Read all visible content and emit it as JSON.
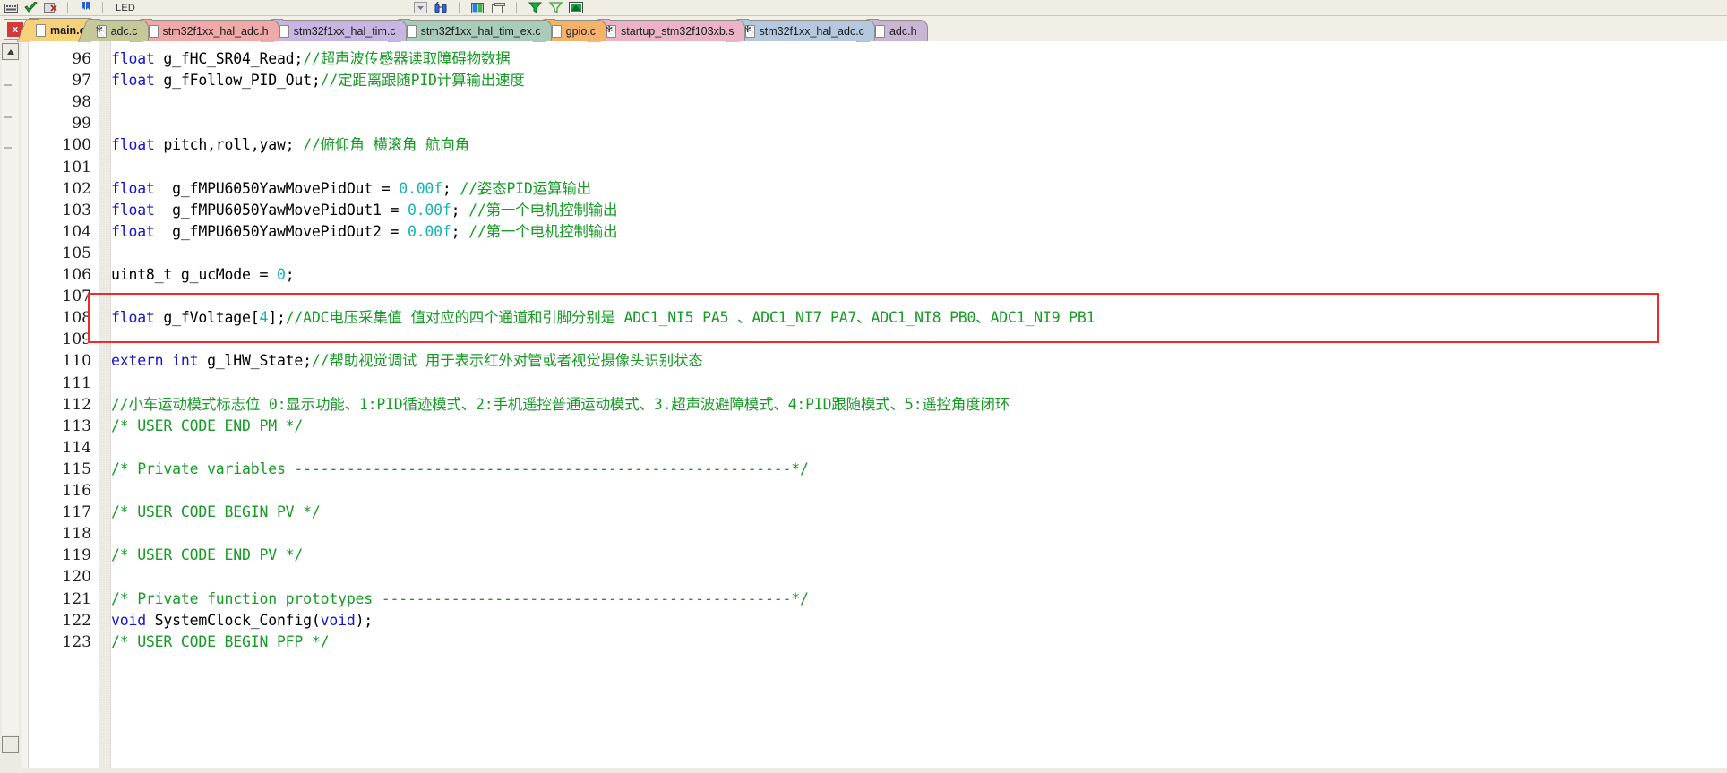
{
  "window": {
    "title": "main.c",
    "app": "Keil uVision Editor"
  },
  "toolbar": {
    "label_text": "LED",
    "icons": [
      "keyboard-icon",
      "checkmark-green-icon",
      "erase-bookmarks-icon",
      "bookmark-next-icon",
      "dropdown-arrow-icon",
      "find-binoculars-icon",
      "window-split-icon",
      "window-tile-icon",
      "filter-green-icon",
      "filter-outline-icon",
      "manage-components-icon"
    ]
  },
  "tabbar": {
    "close_label": "x",
    "tabs": [
      {
        "label": "main.c",
        "active": true,
        "color": "#f7d07a",
        "icon": "file-c-icon"
      },
      {
        "label": "adc.c",
        "active": false,
        "color": "#c6c89a",
        "icon": "file-asm-icon"
      },
      {
        "label": "stm32f1xx_hal_adc.h",
        "active": false,
        "color": "#efa9a9",
        "icon": "file-h-icon"
      },
      {
        "label": "stm32f1xx_hal_tim.c",
        "active": false,
        "color": "#c8b6e2",
        "icon": "file-c-icon"
      },
      {
        "label": "stm32f1xx_hal_tim_ex.c",
        "active": false,
        "color": "#a9cbb9",
        "icon": "file-c-icon"
      },
      {
        "label": "gpio.c",
        "active": false,
        "color": "#f5b26b",
        "icon": "file-c-icon"
      },
      {
        "label": "startup_stm32f103xb.s",
        "active": false,
        "color": "#eab4c6",
        "icon": "file-asm-icon"
      },
      {
        "label": "stm32f1xx_hal_adc.c",
        "active": false,
        "color": "#b4c8e0",
        "icon": "file-asm-icon"
      },
      {
        "label": "adc.h",
        "active": false,
        "color": "#c8b6d4",
        "icon": "file-h-icon"
      }
    ]
  },
  "colors": {
    "keyword": "#1414d0",
    "comment": "#179b26",
    "number": "#19b2b2",
    "plain": "#000000",
    "highlight_box": "#ef2b2b",
    "editor_bg": "#ffffff"
  },
  "editor": {
    "first_line_number": 96,
    "highlight": {
      "line": 108,
      "note": "red rectangle drawn around the g_fVoltage declaration line"
    },
    "lines": [
      {
        "n": 96,
        "segments": [
          {
            "t": "float ",
            "c": "kw"
          },
          {
            "t": "g_fHC_SR04_Read;",
            "c": "pl"
          },
          {
            "t": "//超声波传感器读取障碍物数据",
            "c": "cm"
          }
        ]
      },
      {
        "n": 97,
        "segments": [
          {
            "t": "float ",
            "c": "kw"
          },
          {
            "t": "g_fFollow_PID_Out;",
            "c": "pl"
          },
          {
            "t": "//定距离跟随PID计算输出速度",
            "c": "cm"
          }
        ]
      },
      {
        "n": 98,
        "segments": []
      },
      {
        "n": 99,
        "segments": []
      },
      {
        "n": 100,
        "segments": [
          {
            "t": "float ",
            "c": "kw"
          },
          {
            "t": "pitch,roll,yaw; ",
            "c": "pl"
          },
          {
            "t": "//俯仰角 横滚角 航向角",
            "c": "cm"
          }
        ]
      },
      {
        "n": 101,
        "segments": []
      },
      {
        "n": 102,
        "segments": [
          {
            "t": "float  ",
            "c": "kw"
          },
          {
            "t": "g_fMPU6050YawMovePidOut = ",
            "c": "pl"
          },
          {
            "t": "0.00f",
            "c": "num-lit"
          },
          {
            "t": "; ",
            "c": "pl"
          },
          {
            "t": "//姿态PID运算输出",
            "c": "cm"
          }
        ]
      },
      {
        "n": 103,
        "segments": [
          {
            "t": "float  ",
            "c": "kw"
          },
          {
            "t": "g_fMPU6050YawMovePidOut1 = ",
            "c": "pl"
          },
          {
            "t": "0.00f",
            "c": "num-lit"
          },
          {
            "t": "; ",
            "c": "pl"
          },
          {
            "t": "//第一个电机控制输出",
            "c": "cm"
          }
        ]
      },
      {
        "n": 104,
        "segments": [
          {
            "t": "float  ",
            "c": "kw"
          },
          {
            "t": "g_fMPU6050YawMovePidOut2 = ",
            "c": "pl"
          },
          {
            "t": "0.00f",
            "c": "num-lit"
          },
          {
            "t": "; ",
            "c": "pl"
          },
          {
            "t": "//第一个电机控制输出",
            "c": "cm"
          }
        ]
      },
      {
        "n": 105,
        "segments": []
      },
      {
        "n": 106,
        "segments": [
          {
            "t": "uint8_t g_ucMode = ",
            "c": "pl"
          },
          {
            "t": "0",
            "c": "num-lit"
          },
          {
            "t": ";",
            "c": "pl"
          }
        ]
      },
      {
        "n": 107,
        "segments": []
      },
      {
        "n": 108,
        "segments": [
          {
            "t": "float ",
            "c": "kw"
          },
          {
            "t": "g_fVoltage[",
            "c": "pl"
          },
          {
            "t": "4",
            "c": "num-lit"
          },
          {
            "t": "];",
            "c": "pl"
          },
          {
            "t": "//ADC电压采集值 值对应的四个通道和引脚分别是 ADC1_NI5 PA5 、ADC1_NI7 PA7、ADC1_NI8 PB0、ADC1_NI9 PB1",
            "c": "cm"
          }
        ]
      },
      {
        "n": 109,
        "segments": []
      },
      {
        "n": 110,
        "segments": [
          {
            "t": "extern int ",
            "c": "kw"
          },
          {
            "t": "g_lHW_State;",
            "c": "pl"
          },
          {
            "t": "//帮助视觉调试 用于表示红外对管或者视觉摄像头识别状态",
            "c": "cm"
          }
        ]
      },
      {
        "n": 111,
        "segments": []
      },
      {
        "n": 112,
        "segments": [
          {
            "t": "//小车运动模式标志位 0:显示功能、1:PID循迹模式、2:手机遥控普通运动模式、3.超声波避障模式、4:PID跟随模式、5:遥控角度闭环",
            "c": "cm"
          }
        ]
      },
      {
        "n": 113,
        "segments": [
          {
            "t": "/* USER CODE END PM */",
            "c": "cm"
          }
        ]
      },
      {
        "n": 114,
        "segments": []
      },
      {
        "n": 115,
        "segments": [
          {
            "t": "/* Private variables ---------------------------------------------------------*/",
            "c": "cm"
          }
        ]
      },
      {
        "n": 116,
        "segments": []
      },
      {
        "n": 117,
        "segments": [
          {
            "t": "/* USER CODE BEGIN PV */",
            "c": "cm"
          }
        ]
      },
      {
        "n": 118,
        "segments": []
      },
      {
        "n": 119,
        "segments": [
          {
            "t": "/* USER CODE END PV */",
            "c": "cm"
          }
        ]
      },
      {
        "n": 120,
        "segments": []
      },
      {
        "n": 121,
        "segments": [
          {
            "t": "/* Private function prototypes -----------------------------------------------*/",
            "c": "cm"
          }
        ]
      },
      {
        "n": 122,
        "segments": [
          {
            "t": "void ",
            "c": "kw"
          },
          {
            "t": "SystemClock_Config(",
            "c": "pl"
          },
          {
            "t": "void",
            "c": "kw"
          },
          {
            "t": ");",
            "c": "pl"
          }
        ]
      },
      {
        "n": 123,
        "segments": [
          {
            "t": "/* USER CODE BEGIN PFP */",
            "c": "cm"
          }
        ]
      }
    ]
  },
  "scrollbar": {
    "up_arrow": "scroll-up-icon",
    "down_arrow": "scroll-down-icon"
  }
}
